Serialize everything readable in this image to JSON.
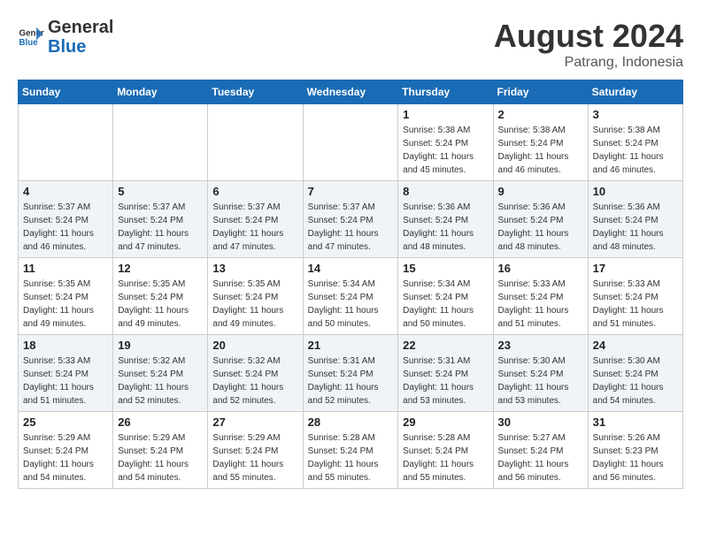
{
  "logo": {
    "text_general": "General",
    "text_blue": "Blue"
  },
  "title": "August 2024",
  "location": "Patrang, Indonesia",
  "days_of_week": [
    "Sunday",
    "Monday",
    "Tuesday",
    "Wednesday",
    "Thursday",
    "Friday",
    "Saturday"
  ],
  "weeks": [
    [
      {
        "day": "",
        "info": ""
      },
      {
        "day": "",
        "info": ""
      },
      {
        "day": "",
        "info": ""
      },
      {
        "day": "",
        "info": ""
      },
      {
        "day": "1",
        "sunrise": "5:38 AM",
        "sunset": "5:24 PM",
        "daylight": "11 hours and 45 minutes."
      },
      {
        "day": "2",
        "sunrise": "5:38 AM",
        "sunset": "5:24 PM",
        "daylight": "11 hours and 46 minutes."
      },
      {
        "day": "3",
        "sunrise": "5:38 AM",
        "sunset": "5:24 PM",
        "daylight": "11 hours and 46 minutes."
      }
    ],
    [
      {
        "day": "4",
        "sunrise": "5:37 AM",
        "sunset": "5:24 PM",
        "daylight": "11 hours and 46 minutes."
      },
      {
        "day": "5",
        "sunrise": "5:37 AM",
        "sunset": "5:24 PM",
        "daylight": "11 hours and 47 minutes."
      },
      {
        "day": "6",
        "sunrise": "5:37 AM",
        "sunset": "5:24 PM",
        "daylight": "11 hours and 47 minutes."
      },
      {
        "day": "7",
        "sunrise": "5:37 AM",
        "sunset": "5:24 PM",
        "daylight": "11 hours and 47 minutes."
      },
      {
        "day": "8",
        "sunrise": "5:36 AM",
        "sunset": "5:24 PM",
        "daylight": "11 hours and 48 minutes."
      },
      {
        "day": "9",
        "sunrise": "5:36 AM",
        "sunset": "5:24 PM",
        "daylight": "11 hours and 48 minutes."
      },
      {
        "day": "10",
        "sunrise": "5:36 AM",
        "sunset": "5:24 PM",
        "daylight": "11 hours and 48 minutes."
      }
    ],
    [
      {
        "day": "11",
        "sunrise": "5:35 AM",
        "sunset": "5:24 PM",
        "daylight": "11 hours and 49 minutes."
      },
      {
        "day": "12",
        "sunrise": "5:35 AM",
        "sunset": "5:24 PM",
        "daylight": "11 hours and 49 minutes."
      },
      {
        "day": "13",
        "sunrise": "5:35 AM",
        "sunset": "5:24 PM",
        "daylight": "11 hours and 49 minutes."
      },
      {
        "day": "14",
        "sunrise": "5:34 AM",
        "sunset": "5:24 PM",
        "daylight": "11 hours and 50 minutes."
      },
      {
        "day": "15",
        "sunrise": "5:34 AM",
        "sunset": "5:24 PM",
        "daylight": "11 hours and 50 minutes."
      },
      {
        "day": "16",
        "sunrise": "5:33 AM",
        "sunset": "5:24 PM",
        "daylight": "11 hours and 51 minutes."
      },
      {
        "day": "17",
        "sunrise": "5:33 AM",
        "sunset": "5:24 PM",
        "daylight": "11 hours and 51 minutes."
      }
    ],
    [
      {
        "day": "18",
        "sunrise": "5:33 AM",
        "sunset": "5:24 PM",
        "daylight": "11 hours and 51 minutes."
      },
      {
        "day": "19",
        "sunrise": "5:32 AM",
        "sunset": "5:24 PM",
        "daylight": "11 hours and 52 minutes."
      },
      {
        "day": "20",
        "sunrise": "5:32 AM",
        "sunset": "5:24 PM",
        "daylight": "11 hours and 52 minutes."
      },
      {
        "day": "21",
        "sunrise": "5:31 AM",
        "sunset": "5:24 PM",
        "daylight": "11 hours and 52 minutes."
      },
      {
        "day": "22",
        "sunrise": "5:31 AM",
        "sunset": "5:24 PM",
        "daylight": "11 hours and 53 minutes."
      },
      {
        "day": "23",
        "sunrise": "5:30 AM",
        "sunset": "5:24 PM",
        "daylight": "11 hours and 53 minutes."
      },
      {
        "day": "24",
        "sunrise": "5:30 AM",
        "sunset": "5:24 PM",
        "daylight": "11 hours and 54 minutes."
      }
    ],
    [
      {
        "day": "25",
        "sunrise": "5:29 AM",
        "sunset": "5:24 PM",
        "daylight": "11 hours and 54 minutes."
      },
      {
        "day": "26",
        "sunrise": "5:29 AM",
        "sunset": "5:24 PM",
        "daylight": "11 hours and 54 minutes."
      },
      {
        "day": "27",
        "sunrise": "5:29 AM",
        "sunset": "5:24 PM",
        "daylight": "11 hours and 55 minutes."
      },
      {
        "day": "28",
        "sunrise": "5:28 AM",
        "sunset": "5:24 PM",
        "daylight": "11 hours and 55 minutes."
      },
      {
        "day": "29",
        "sunrise": "5:28 AM",
        "sunset": "5:24 PM",
        "daylight": "11 hours and 55 minutes."
      },
      {
        "day": "30",
        "sunrise": "5:27 AM",
        "sunset": "5:24 PM",
        "daylight": "11 hours and 56 minutes."
      },
      {
        "day": "31",
        "sunrise": "5:26 AM",
        "sunset": "5:23 PM",
        "daylight": "11 hours and 56 minutes."
      }
    ]
  ]
}
